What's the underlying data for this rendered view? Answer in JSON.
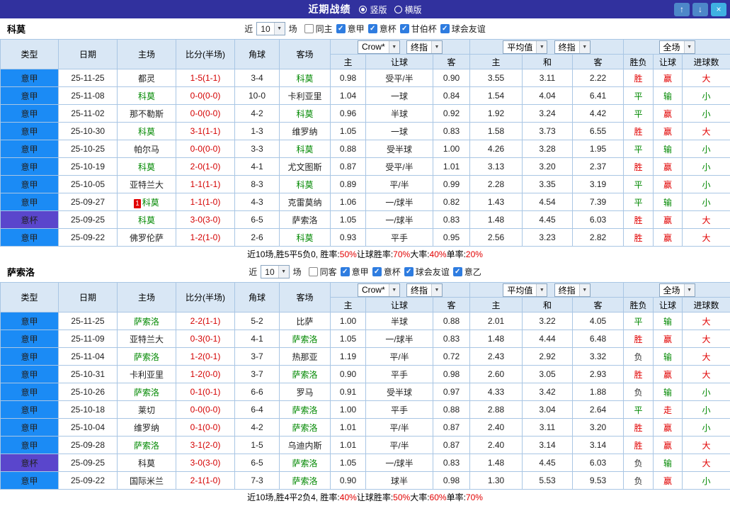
{
  "titlebar": {
    "title": "近期战绩",
    "radios": [
      {
        "label": "竖版",
        "selected": true
      },
      {
        "label": "横版",
        "selected": false
      }
    ],
    "buttons": {
      "up": "↑",
      "down": "↓",
      "close": "×"
    }
  },
  "controls": {
    "recent_label": "近",
    "recent_count": "10",
    "matches_label": "场"
  },
  "table": {
    "main_headers": [
      "类型",
      "日期",
      "主场",
      "比分(半场)",
      "角球",
      "客场"
    ],
    "sub_headers": [
      "主",
      "让球",
      "客",
      "主",
      "和",
      "客",
      "胜负",
      "让球",
      "进球数"
    ],
    "selects": {
      "company": "Crow*",
      "final_a": "终指",
      "average": "平均值",
      "final_b": "终指",
      "scope": "全场"
    }
  },
  "colors": {
    "league": {
      "意甲": "#1b8bf5",
      "意杯": "#5a46cc"
    },
    "values": {
      "胜": "#e10000",
      "平": "#008800",
      "负": "#333333",
      "赢": "#e10000",
      "输": "#008800",
      "走": "#e10000",
      "大": "#e10000",
      "小": "#008800"
    },
    "score": "#d40000",
    "focus_team": "#008800"
  },
  "sections": [
    {
      "team": "科莫",
      "filters": [
        {
          "label": "同主",
          "checked": false
        },
        {
          "label": "意甲",
          "checked": true
        },
        {
          "label": "意杯",
          "checked": true
        },
        {
          "label": "甘伯杯",
          "checked": true
        },
        {
          "label": "球会友谊",
          "checked": true
        }
      ],
      "rows": [
        {
          "league": "意甲",
          "date": "25-11-25",
          "home": "都灵",
          "score": "1-5(1-1)",
          "corner": "3-4",
          "away": "科莫",
          "focus": "away",
          "odds": [
            "0.98",
            "受平/半",
            "0.90"
          ],
          "euro": [
            "3.55",
            "3.11",
            "2.22"
          ],
          "result": "胜",
          "handicap_result": "赢",
          "goals": "大"
        },
        {
          "league": "意甲",
          "date": "25-11-08",
          "home": "科莫",
          "score": "0-0(0-0)",
          "corner": "10-0",
          "away": "卡利亚里",
          "focus": "home",
          "odds": [
            "1.04",
            "一球",
            "0.84"
          ],
          "euro": [
            "1.54",
            "4.04",
            "6.41"
          ],
          "result": "平",
          "handicap_result": "输",
          "goals": "小"
        },
        {
          "league": "意甲",
          "date": "25-11-02",
          "home": "那不勒斯",
          "score": "0-0(0-0)",
          "corner": "4-2",
          "away": "科莫",
          "focus": "away",
          "odds": [
            "0.96",
            "半球",
            "0.92"
          ],
          "euro": [
            "1.92",
            "3.24",
            "4.42"
          ],
          "result": "平",
          "handicap_result": "赢",
          "goals": "小"
        },
        {
          "league": "意甲",
          "date": "25-10-30",
          "home": "科莫",
          "score": "3-1(1-1)",
          "corner": "1-3",
          "away": "维罗纳",
          "focus": "home",
          "odds": [
            "1.05",
            "一球",
            "0.83"
          ],
          "euro": [
            "1.58",
            "3.73",
            "6.55"
          ],
          "result": "胜",
          "handicap_result": "赢",
          "goals": "大"
        },
        {
          "league": "意甲",
          "date": "25-10-25",
          "home": "帕尔马",
          "score": "0-0(0-0)",
          "corner": "3-3",
          "away": "科莫",
          "focus": "away",
          "odds": [
            "0.88",
            "受半球",
            "1.00"
          ],
          "euro": [
            "4.26",
            "3.28",
            "1.95"
          ],
          "result": "平",
          "handicap_result": "输",
          "goals": "小"
        },
        {
          "league": "意甲",
          "date": "25-10-19",
          "home": "科莫",
          "score": "2-0(1-0)",
          "corner": "4-1",
          "away": "尤文图斯",
          "focus": "home",
          "odds": [
            "0.87",
            "受平/半",
            "1.01"
          ],
          "euro": [
            "3.13",
            "3.20",
            "2.37"
          ],
          "result": "胜",
          "handicap_result": "赢",
          "goals": "小"
        },
        {
          "league": "意甲",
          "date": "25-10-05",
          "home": "亚特兰大",
          "score": "1-1(1-1)",
          "corner": "8-3",
          "away": "科莫",
          "focus": "away",
          "odds": [
            "0.89",
            "平/半",
            "0.99"
          ],
          "euro": [
            "2.28",
            "3.35",
            "3.19"
          ],
          "result": "平",
          "handicap_result": "赢",
          "goals": "小"
        },
        {
          "league": "意甲",
          "date": "25-09-27",
          "home": "科莫",
          "badge": "1",
          "score": "1-1(1-0)",
          "corner": "4-3",
          "away": "克雷莫纳",
          "focus": "home",
          "odds": [
            "1.06",
            "一/球半",
            "0.82"
          ],
          "euro": [
            "1.43",
            "4.54",
            "7.39"
          ],
          "result": "平",
          "handicap_result": "输",
          "goals": "小"
        },
        {
          "league": "意杯",
          "date": "25-09-25",
          "home": "科莫",
          "score": "3-0(3-0)",
          "corner": "6-5",
          "away": "萨索洛",
          "focus": "home",
          "odds": [
            "1.05",
            "一/球半",
            "0.83"
          ],
          "euro": [
            "1.48",
            "4.45",
            "6.03"
          ],
          "result": "胜",
          "handicap_result": "赢",
          "goals": "大"
        },
        {
          "league": "意甲",
          "date": "25-09-22",
          "home": "佛罗伦萨",
          "score": "1-2(1-0)",
          "corner": "2-6",
          "away": "科莫",
          "focus": "away",
          "odds": [
            "0.93",
            "平手",
            "0.95"
          ],
          "euro": [
            "2.56",
            "3.23",
            "2.82"
          ],
          "result": "胜",
          "handicap_result": "赢",
          "goals": "大"
        }
      ],
      "summary": [
        {
          "text": "近10场,胜5平5负0, 胜率:",
          "color": "#000000"
        },
        {
          "text": "50%",
          "color": "#e10000"
        },
        {
          "text": " 让球胜率:",
          "color": "#000000"
        },
        {
          "text": "70%",
          "color": "#e10000"
        },
        {
          "text": " 大率:",
          "color": "#000000"
        },
        {
          "text": "40%",
          "color": "#e10000"
        },
        {
          "text": " 单率:",
          "color": "#000000"
        },
        {
          "text": "20%",
          "color": "#e10000"
        }
      ]
    },
    {
      "team": "萨索洛",
      "filters": [
        {
          "label": "同客",
          "checked": false
        },
        {
          "label": "意甲",
          "checked": true
        },
        {
          "label": "意杯",
          "checked": true
        },
        {
          "label": "球会友谊",
          "checked": true
        },
        {
          "label": "意乙",
          "checked": true
        }
      ],
      "rows": [
        {
          "league": "意甲",
          "date": "25-11-25",
          "home": "萨索洛",
          "score": "2-2(1-1)",
          "corner": "5-2",
          "away": "比萨",
          "focus": "home",
          "odds": [
            "1.00",
            "半球",
            "0.88"
          ],
          "euro": [
            "2.01",
            "3.22",
            "4.05"
          ],
          "result": "平",
          "handicap_result": "输",
          "goals": "大"
        },
        {
          "league": "意甲",
          "date": "25-11-09",
          "home": "亚特兰大",
          "score": "0-3(0-1)",
          "corner": "4-1",
          "away": "萨索洛",
          "focus": "away",
          "odds": [
            "1.05",
            "一/球半",
            "0.83"
          ],
          "euro": [
            "1.48",
            "4.44",
            "6.48"
          ],
          "result": "胜",
          "handicap_result": "赢",
          "goals": "大"
        },
        {
          "league": "意甲",
          "date": "25-11-04",
          "home": "萨索洛",
          "score": "1-2(0-1)",
          "corner": "3-7",
          "away": "热那亚",
          "focus": "home",
          "odds": [
            "1.19",
            "平/半",
            "0.72"
          ],
          "euro": [
            "2.43",
            "2.92",
            "3.32"
          ],
          "result": "负",
          "handicap_result": "输",
          "goals": "大"
        },
        {
          "league": "意甲",
          "date": "25-10-31",
          "home": "卡利亚里",
          "score": "1-2(0-0)",
          "corner": "3-7",
          "away": "萨索洛",
          "focus": "away",
          "odds": [
            "0.90",
            "平手",
            "0.98"
          ],
          "euro": [
            "2.60",
            "3.05",
            "2.93"
          ],
          "result": "胜",
          "handicap_result": "赢",
          "goals": "大"
        },
        {
          "league": "意甲",
          "date": "25-10-26",
          "home": "萨索洛",
          "score": "0-1(0-1)",
          "corner": "6-6",
          "away": "罗马",
          "focus": "home",
          "odds": [
            "0.91",
            "受半球",
            "0.97"
          ],
          "euro": [
            "4.33",
            "3.42",
            "1.88"
          ],
          "result": "负",
          "handicap_result": "输",
          "goals": "小"
        },
        {
          "league": "意甲",
          "date": "25-10-18",
          "home": "莱切",
          "score": "0-0(0-0)",
          "corner": "6-4",
          "away": "萨索洛",
          "focus": "away",
          "odds": [
            "1.00",
            "平手",
            "0.88"
          ],
          "euro": [
            "2.88",
            "3.04",
            "2.64"
          ],
          "result": "平",
          "handicap_result": "走",
          "goals": "小"
        },
        {
          "league": "意甲",
          "date": "25-10-04",
          "home": "维罗纳",
          "score": "0-1(0-0)",
          "corner": "4-2",
          "away": "萨索洛",
          "focus": "away",
          "odds": [
            "1.01",
            "平/半",
            "0.87"
          ],
          "euro": [
            "2.40",
            "3.11",
            "3.20"
          ],
          "result": "胜",
          "handicap_result": "赢",
          "goals": "小"
        },
        {
          "league": "意甲",
          "date": "25-09-28",
          "home": "萨索洛",
          "score": "3-1(2-0)",
          "corner": "1-5",
          "away": "乌迪内斯",
          "focus": "home",
          "odds": [
            "1.01",
            "平/半",
            "0.87"
          ],
          "euro": [
            "2.40",
            "3.14",
            "3.14"
          ],
          "result": "胜",
          "handicap_result": "赢",
          "goals": "大"
        },
        {
          "league": "意杯",
          "date": "25-09-25",
          "home": "科莫",
          "score": "3-0(3-0)",
          "corner": "6-5",
          "away": "萨索洛",
          "focus": "away",
          "odds": [
            "1.05",
            "一/球半",
            "0.83"
          ],
          "euro": [
            "1.48",
            "4.45",
            "6.03"
          ],
          "result": "负",
          "handicap_result": "输",
          "goals": "大"
        },
        {
          "league": "意甲",
          "date": "25-09-22",
          "home": "国际米兰",
          "score": "2-1(1-0)",
          "corner": "7-3",
          "away": "萨索洛",
          "focus": "away",
          "odds": [
            "0.90",
            "球半",
            "0.98"
          ],
          "euro": [
            "1.30",
            "5.53",
            "9.53"
          ],
          "result": "负",
          "handicap_result": "赢",
          "goals": "小"
        }
      ],
      "summary": [
        {
          "text": "近10场,胜4平2负4, 胜率:",
          "color": "#000000"
        },
        {
          "text": "40%",
          "color": "#e10000"
        },
        {
          "text": " 让球胜率:",
          "color": "#000000"
        },
        {
          "text": "50%",
          "color": "#e10000"
        },
        {
          "text": " 大率:",
          "color": "#000000"
        },
        {
          "text": "60%",
          "color": "#e10000"
        },
        {
          "text": " 单率:",
          "color": "#000000"
        },
        {
          "text": "70%",
          "color": "#e10000"
        }
      ]
    }
  ]
}
